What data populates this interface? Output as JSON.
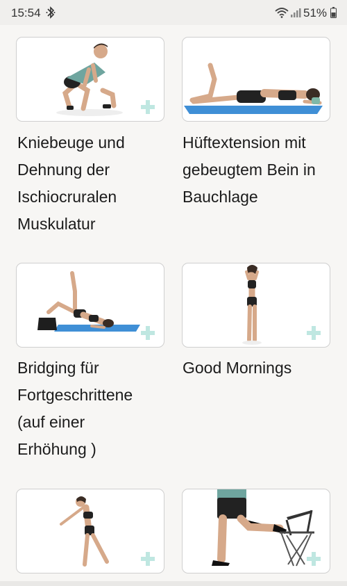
{
  "status_bar": {
    "time": "15:54",
    "battery": "51%",
    "icons": [
      "bluetooth-icon",
      "wifi-icon",
      "signal-icon",
      "battery-icon"
    ]
  },
  "exercises": [
    {
      "title": "Kniebeuge und\nDehnung der\nIschiocruralen\nMuskulatur",
      "image_icon": "squat-figure"
    },
    {
      "title": "Hüftextension mit\ngebeugtem Bein in\nBauchlage",
      "image_icon": "prone-hip-extension-figure"
    },
    {
      "title": "Bridging für\nFortgeschrittene\n(auf einer\nErhöhung )",
      "image_icon": "bridging-figure"
    },
    {
      "title": "Good Mornings",
      "image_icon": "standing-figure"
    },
    {
      "title": "",
      "image_icon": "balance-reach-figure"
    },
    {
      "title": "",
      "image_icon": "chair-lunge-figure"
    }
  ],
  "colors": {
    "accent_plus": "#bfe7e1",
    "mat_blue": "#3f8fd6",
    "card_border": "#cfcfcf",
    "background": "#f7f6f4"
  }
}
